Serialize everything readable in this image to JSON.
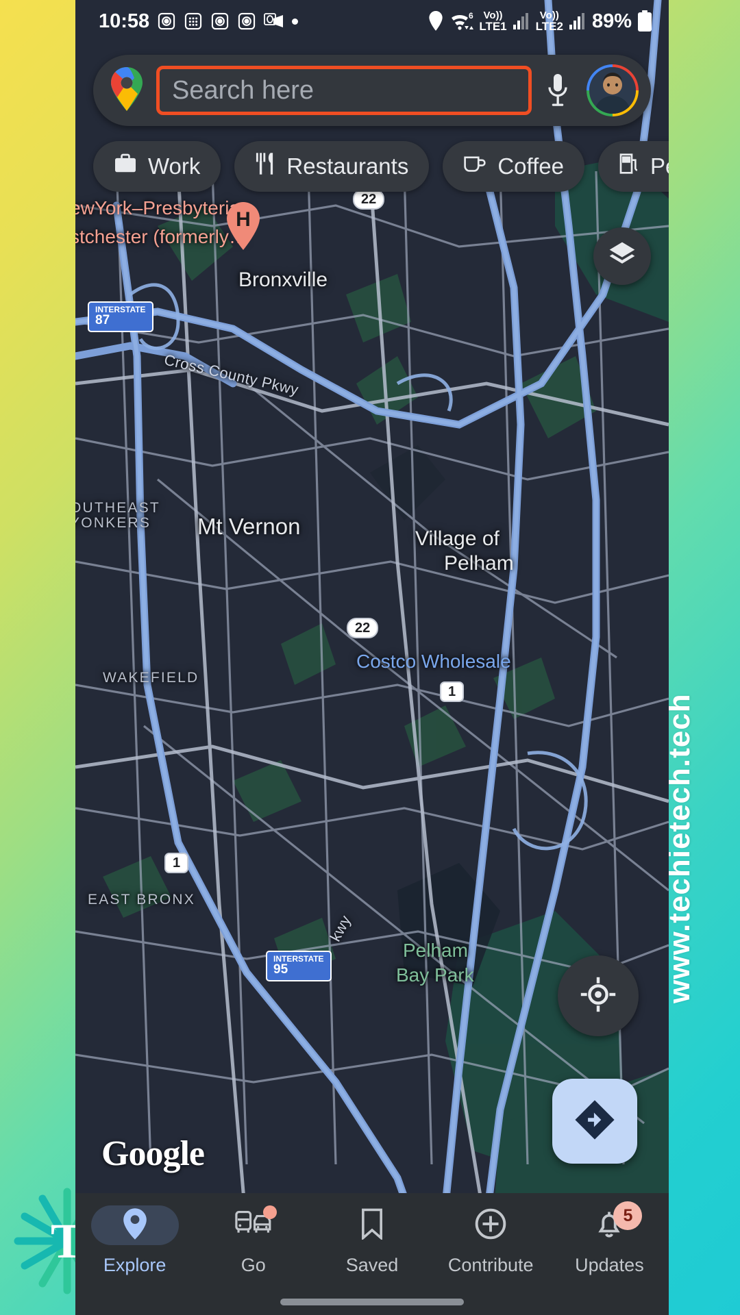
{
  "watermark": {
    "text": "www.techietech.tech",
    "logo_letter": "T"
  },
  "status_bar": {
    "time": "10:58",
    "left_icons": [
      "camera-icon",
      "apps-icon",
      "camera-icon",
      "camera-icon",
      "outlook-icon",
      "dot-icon"
    ],
    "right_icons": [
      "location-icon",
      "wifi-icon"
    ],
    "wifi_gen": "6",
    "sim1_volte": "Vo))",
    "sim1_label": "LTE1",
    "sim2_volte": "Vo))",
    "sim2_label": "LTE2",
    "battery_percent": "89%"
  },
  "search": {
    "placeholder": "Search here",
    "highlight_color": "#f04e23",
    "mic_icon": "microphone-icon",
    "maps_icon": "google-maps-pin-icon",
    "avatar_icon": "user-avatar"
  },
  "chips": [
    {
      "label": "Work",
      "icon": "briefcase-icon"
    },
    {
      "label": "Restaurants",
      "icon": "restaurant-icon"
    },
    {
      "label": "Coffee",
      "icon": "coffee-cup-icon"
    },
    {
      "label": "Pe",
      "icon": "gas-pump-icon"
    }
  ],
  "map": {
    "poi_label": "ewYork–Presbyterian\nstchester (formerly…",
    "poi_line1": "ewYork–Presbyterian",
    "poi_line2": "stchester (formerly…",
    "hospital_marker": "H",
    "places": [
      {
        "name": "Bronxville",
        "type": "city"
      },
      {
        "name": "Mt Vernon",
        "type": "city"
      },
      {
        "name": "Village of",
        "type": "city"
      },
      {
        "name": "Pelham",
        "type": "city"
      },
      {
        "name": "OUTHEAST",
        "type": "neighborhood"
      },
      {
        "name": "YONKERS",
        "type": "neighborhood"
      },
      {
        "name": "WAKEFIELD",
        "type": "neighborhood"
      },
      {
        "name": "EAST BRONX",
        "type": "neighborhood"
      }
    ],
    "business": "Costco Wholesale",
    "park_line1": "Pelham",
    "park_line2": "Bay Park",
    "road_label": "Cross County Pkwy",
    "road_label2": "kwy",
    "shields": [
      {
        "num": "22",
        "kind": "state"
      },
      {
        "num": "22",
        "kind": "state"
      },
      {
        "num": "1",
        "kind": "us"
      },
      {
        "num": "1",
        "kind": "us"
      },
      {
        "num": "87",
        "kind": "interstate"
      },
      {
        "num": "95",
        "kind": "interstate"
      }
    ],
    "interstate_label": "INTERSTATE",
    "attribution": "Google",
    "controls": {
      "layers": "layers-icon",
      "my_location": "my-location-icon",
      "directions": "directions-icon"
    }
  },
  "bottom_nav": {
    "items": [
      {
        "label": "Explore",
        "icon": "map-pin-icon",
        "active": true,
        "badge": "",
        "dot": false
      },
      {
        "label": "Go",
        "icon": "commute-icon",
        "active": false,
        "badge": "",
        "dot": true
      },
      {
        "label": "Saved",
        "icon": "bookmark-icon",
        "active": false,
        "badge": "",
        "dot": false
      },
      {
        "label": "Contribute",
        "icon": "plus-circle-icon",
        "active": false,
        "badge": "",
        "dot": false
      },
      {
        "label": "Updates",
        "icon": "bell-icon",
        "active": false,
        "badge": "5",
        "dot": false
      }
    ]
  }
}
